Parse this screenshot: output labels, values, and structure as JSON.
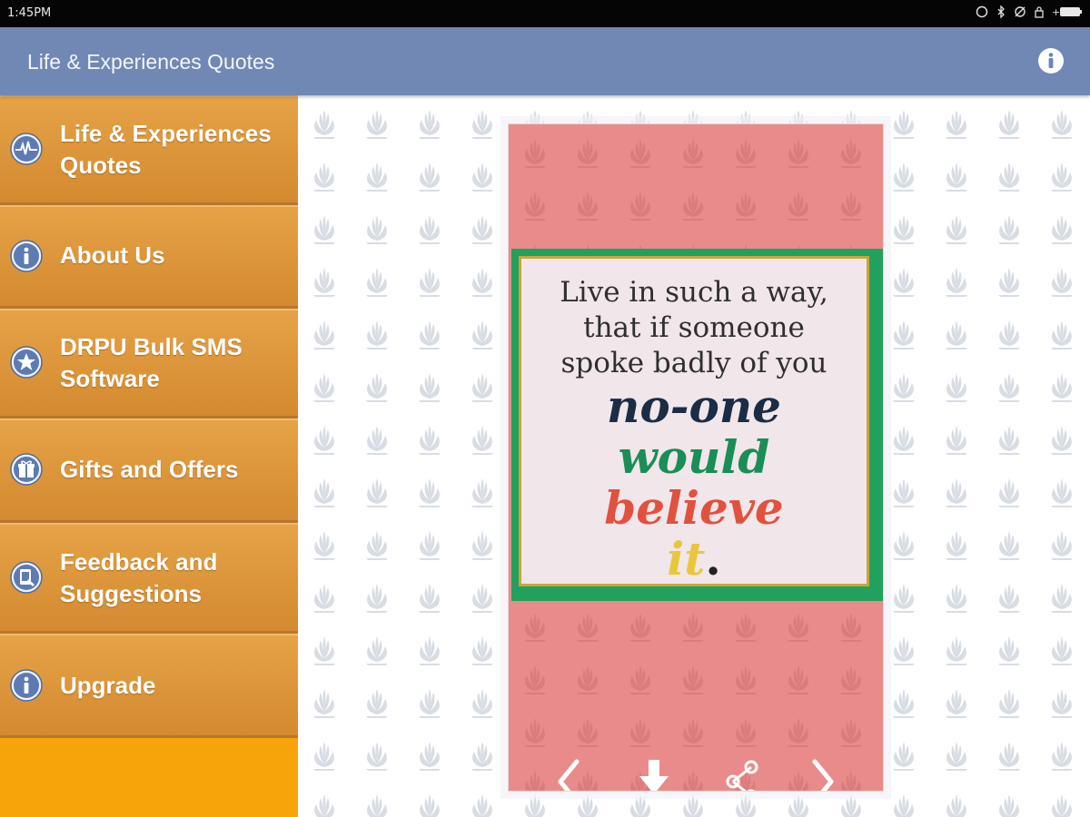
{
  "status_bar": {
    "time": "1:45PM"
  },
  "action_bar": {
    "title": "Life & Experiences Quotes",
    "info_icon": "info-icon"
  },
  "drawer": {
    "items": [
      {
        "line1": "Life & Experiences",
        "line2": "Quotes",
        "icon": "pulse-icon"
      },
      {
        "line1": "About Us",
        "line2": "",
        "icon": "info-icon"
      },
      {
        "line1": "DRPU Bulk SMS",
        "line2": "Software",
        "icon": "star-icon"
      },
      {
        "line1": "Gifts and Offers",
        "line2": "",
        "icon": "gift-icon"
      },
      {
        "line1": "Feedback and",
        "line2": "Suggestions",
        "icon": "feedback-icon"
      },
      {
        "line1": "Upgrade",
        "line2": "",
        "icon": "info-icon"
      }
    ]
  },
  "quote": {
    "line1": "Live in such a way,",
    "line2": "that if someone",
    "line3": "spoke badly of you",
    "word1": "no-one",
    "word2": "would",
    "word3": "believe",
    "word4": "it",
    "end": "."
  },
  "controls": {
    "previous": "chevron-left-icon",
    "download": "download-icon",
    "share": "share-icon",
    "next": "chevron-right-icon"
  },
  "colors": {
    "action_bar": "#7088b3",
    "drawer": "#f7a30a",
    "card": "#e98b8b",
    "quote_border": "#21a15d"
  }
}
